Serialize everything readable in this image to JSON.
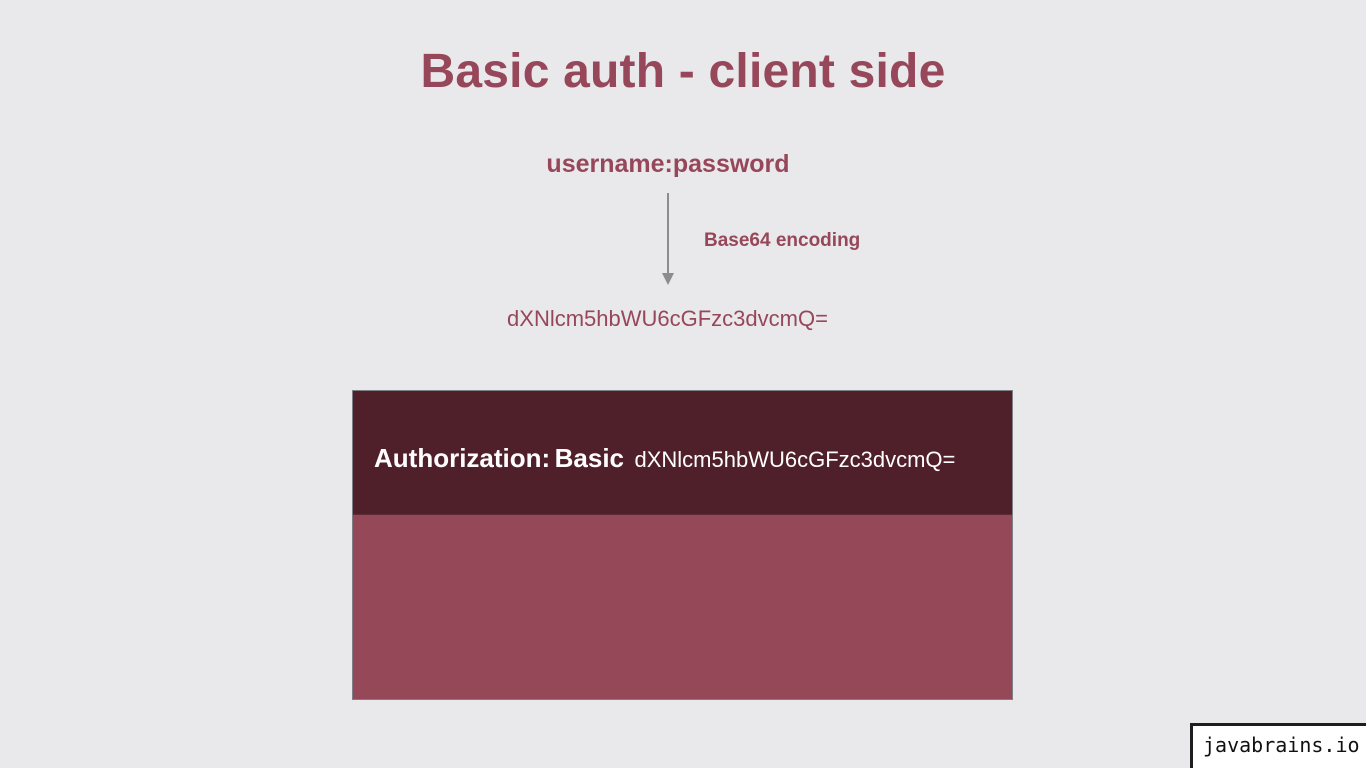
{
  "slide": {
    "title": "Basic auth - client side",
    "credentials": "username:password",
    "encoding_label": "Base64 encoding",
    "encoded_value": "dXNlcm5hbWU6cGFzc3dvcmQ="
  },
  "request": {
    "header_key": "Authorization:",
    "header_scheme": "Basic",
    "header_value": "dXNlcm5hbWU6cGFzc3dvcmQ="
  },
  "watermark": "javabrains.io",
  "colors": {
    "accent": "#97475a",
    "header_bg": "#50202a",
    "body_bg": "#944858",
    "page_bg": "#e9e8eb",
    "arrow": "#8c8c8c"
  }
}
